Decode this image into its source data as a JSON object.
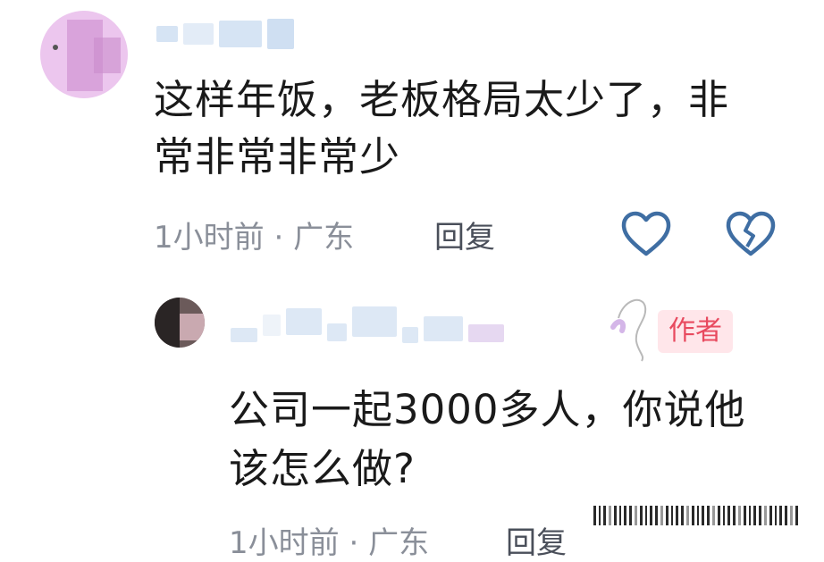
{
  "comment": {
    "username_blurred": true,
    "text_line1": "这样年饭，老板格局太少了，非",
    "text_line2": "常非常非常少",
    "time": "1小时前",
    "separator": "·",
    "location": "广东",
    "reply_label": "回复"
  },
  "reply": {
    "username_blurred": true,
    "author_tag": "作者",
    "text_line1": "公司一起3000多人，你说他",
    "text_line2": "该怎么做?",
    "time": "1小时前",
    "separator": "·",
    "location": "广东",
    "reply_label": "回复"
  },
  "icons": {
    "like": "heart-outline-icon",
    "dislike": "broken-heart-icon"
  },
  "colors": {
    "text": "#1a1a1a",
    "meta": "#8a8f99",
    "icon_blue": "#3f6ea3",
    "author_tag_bg": "#ffe6ea",
    "author_tag_fg": "#e84a5f"
  }
}
